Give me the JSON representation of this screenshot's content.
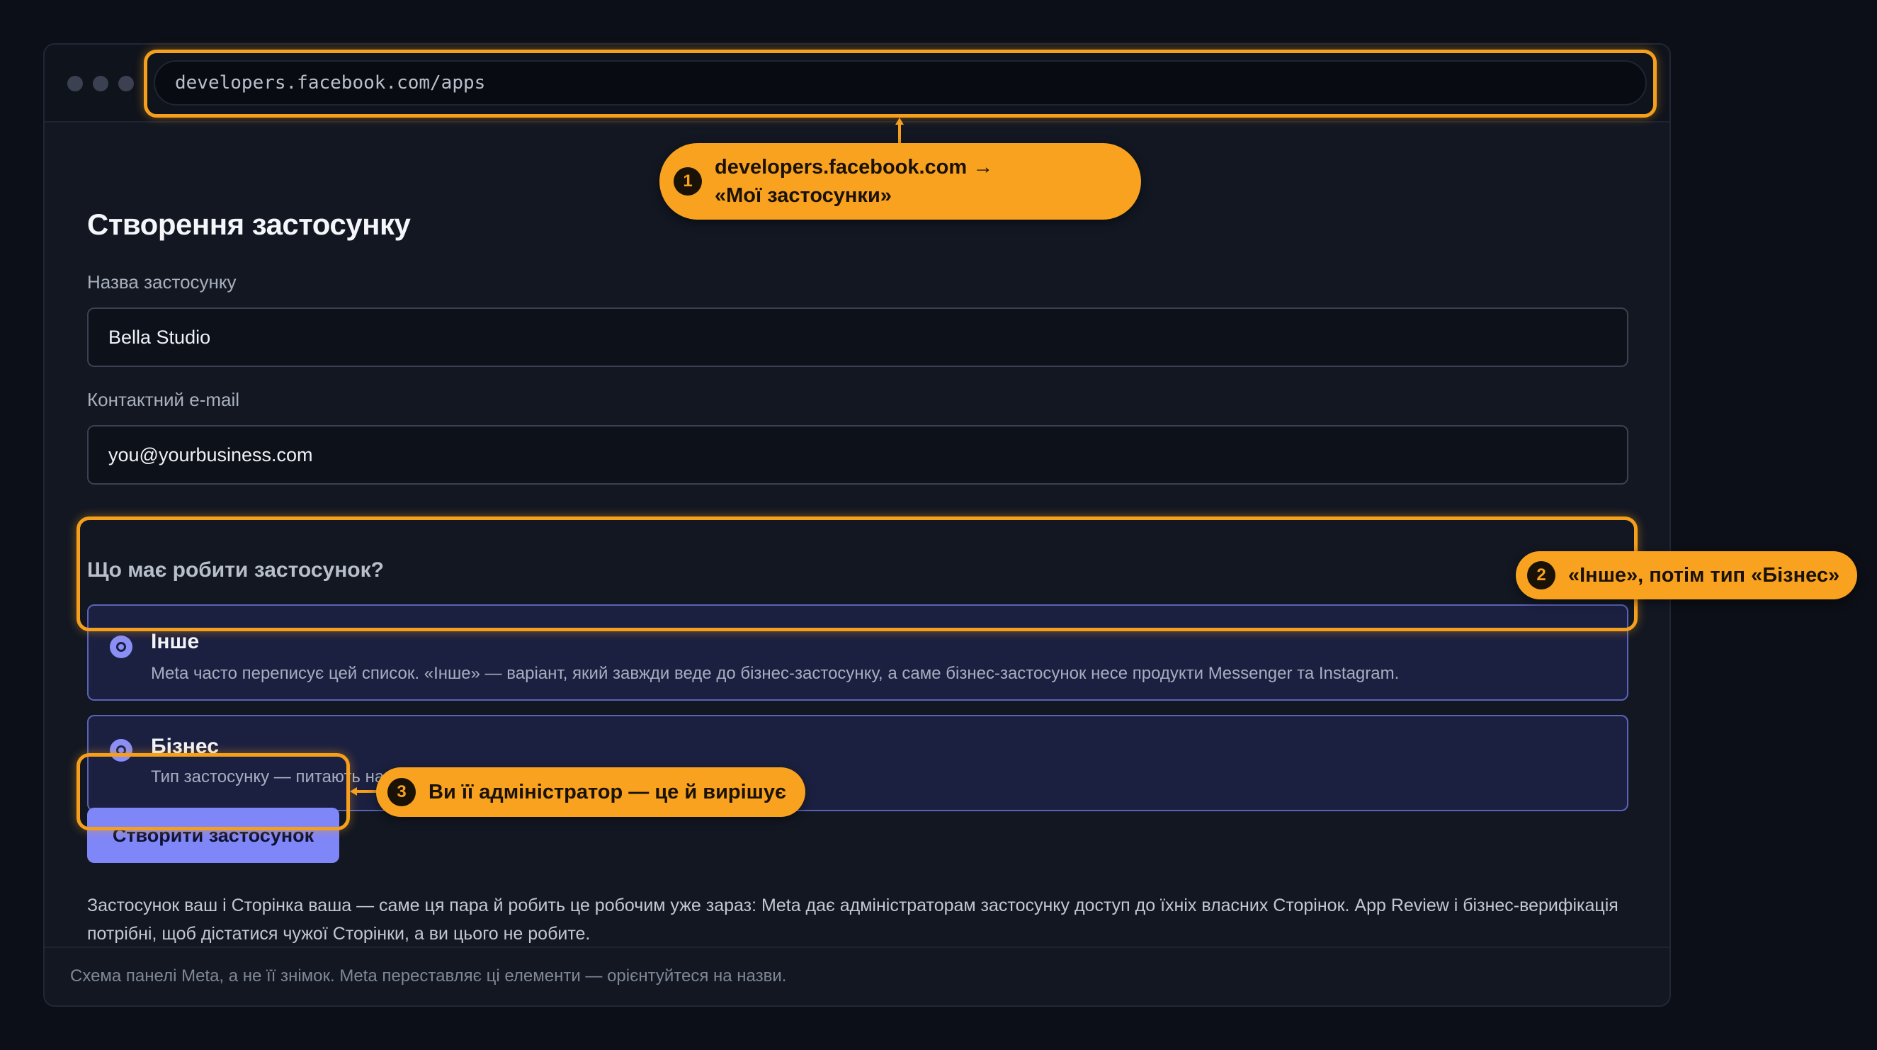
{
  "browser": {
    "url": "developers.facebook.com/apps"
  },
  "page": {
    "title": "Створення застосунку",
    "app_name_label": "Назва застосунку",
    "app_name_value": "Bella Studio",
    "email_label": "Контактний e-mail",
    "email_value": "you@yourbusiness.com",
    "question": "Що має робити застосунок?",
    "options": [
      {
        "title": "Інше",
        "description": "Meta часто переписує цей список. «Інше» — варіант, який завжди веде до бізнес-застосунку, а саме бізнес-застосунок несе продукти Messenger та Instagram."
      },
      {
        "title": "Бізнес",
        "description": "Тип застосунку — питають на наступному екрані."
      }
    ],
    "create_button": "Створити застосунок",
    "body_text": "Застосунок ваш і Сторінка ваша — саме ця пара й робить це робочим уже зараз: Meta дає адміністраторам застосунку доступ до їхніх власних Сторінок. App Review і бізнес-верифікація потрібні, щоб дістатися чужої Сторінки, а ви цього не робите.",
    "footer_note": "Схема панелі Meta, а не її знімок. Meta переставляє ці елементи — орієнтуйтеся на назви."
  },
  "annotations": [
    {
      "number": "1",
      "line1": "developers.facebook.com →",
      "line2": "«Мої застосунки»"
    },
    {
      "number": "2",
      "text": "«Інше», потім тип «Бізнес»"
    },
    {
      "number": "3",
      "text": "Ви її адміністратор — це й вирішує"
    }
  ],
  "colors": {
    "accent": "#f8a21f",
    "primary_button": "#7f86f8",
    "option_bg": "#1b2040",
    "option_border": "#5b63b8",
    "background": "#0c0f17"
  }
}
